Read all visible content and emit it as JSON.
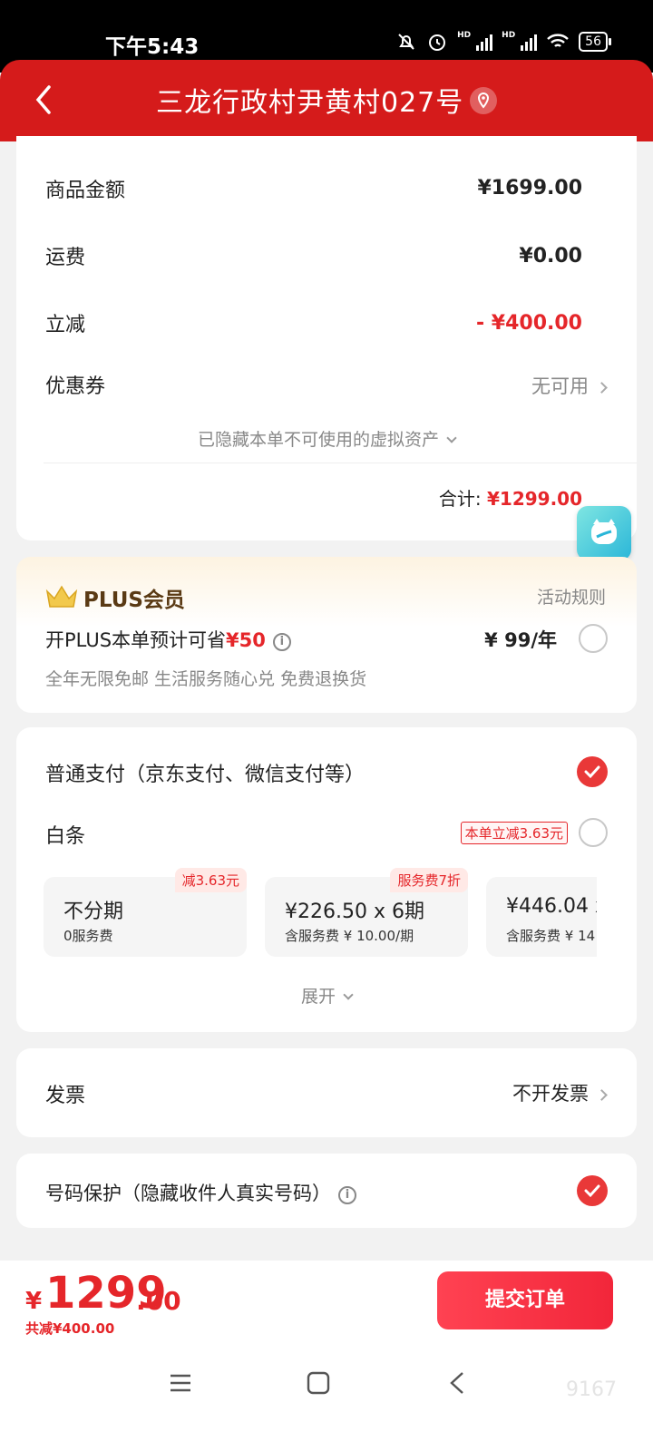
{
  "status_bar": {
    "time": "下午5:43",
    "hd1": "HD",
    "hd2": "HD",
    "battery": "56"
  },
  "header": {
    "title": "三龙行政村尹黄村027号"
  },
  "summary": {
    "goods_label": "商品金额",
    "goods_value": "¥1699.00",
    "shipping_label": "运费",
    "shipping_value": "¥0.00",
    "discount_label": "立减",
    "discount_value": "- ¥400.00",
    "coupon_label": "优惠券",
    "coupon_value": "无可用",
    "hidden_assets": "已隐藏本单不可使用的虚拟资产",
    "subtotal_label": "合计:",
    "subtotal_value": "¥1299.00"
  },
  "plus": {
    "title": "PLUS会员",
    "rules": "活动规则",
    "offer_text": "开PLUS本单预计可省",
    "offer_amount": "¥50",
    "price": "¥ 99/年",
    "benefits": "全年无限免邮 生活服务随心兑 免费退换货"
  },
  "payment": {
    "normal_label": "普通支付（京东支付、微信支付等）",
    "baitiao_label": "白条",
    "baitiao_tag": "本单立减3.63元",
    "plans": [
      {
        "main": "不分期",
        "sub": "0服务费",
        "badge": "减3.63元"
      },
      {
        "main": "¥226.50 x 6期",
        "sub": "含服务费 ¥ 10.00/期",
        "badge": "服务费7折"
      },
      {
        "main": "¥446.04 x",
        "sub": "含服务费 ¥ 14"
      }
    ],
    "expand": "展开"
  },
  "invoice": {
    "label": "发票",
    "value": "不开发票"
  },
  "privacy": {
    "label": "号码保护（隐藏收件人真实号码）"
  },
  "bottom": {
    "currency": "¥",
    "total_int": "1299",
    "total_dec": ".00",
    "saved": "共减¥400.00",
    "submit": "提交订单",
    "watermark": "9167"
  },
  "colors": {
    "brand_red": "#d51b1b",
    "accent_red": "#e5262a"
  }
}
